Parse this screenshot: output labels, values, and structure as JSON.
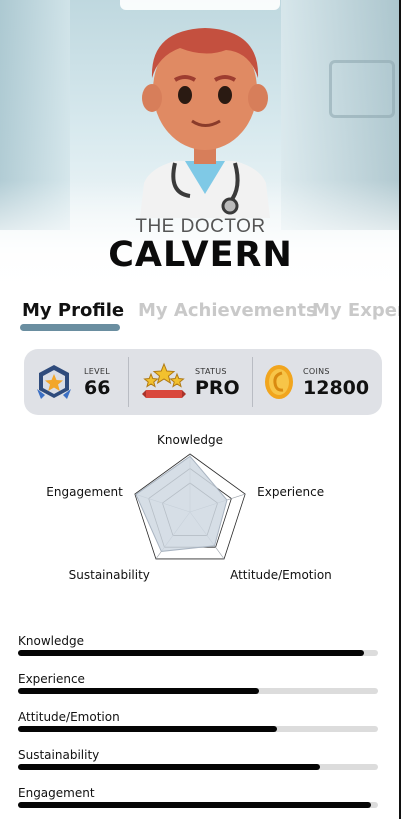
{
  "profile": {
    "subtitle": "THE DOCTOR",
    "name": "CALVERN"
  },
  "tabs": [
    {
      "label": "My Profile",
      "active": true
    },
    {
      "label": "My Achievements",
      "active": false
    },
    {
      "label": "My Exper",
      "active": false
    }
  ],
  "stats": {
    "level": {
      "label": "LEVEL",
      "value": "66",
      "icon": "level-badge-icon"
    },
    "status": {
      "label": "STATUS",
      "value": "PRO",
      "icon": "stars-ribbon-icon"
    },
    "coins": {
      "label": "COINS",
      "value": "12800",
      "icon": "coin-icon"
    }
  },
  "radar": {
    "axes": [
      "Knowledge",
      "Experience",
      "Attitude/Emotion",
      "Sustainability",
      "Engagement"
    ],
    "values": [
      0.96,
      0.67,
      0.72,
      0.84,
      0.98
    ]
  },
  "skills": [
    {
      "label": "Knowledge",
      "value": 0.96
    },
    {
      "label": "Experience",
      "value": 0.67
    },
    {
      "label": "Attitude/Emotion",
      "value": 0.72
    },
    {
      "label": "Sustainability",
      "value": 0.84
    },
    {
      "label": "Engagement",
      "value": 0.98
    }
  ],
  "colors": {
    "tab_underline": "#6a8ea0",
    "stats_panel": "#dfe1e6",
    "bar_fill": "#050505",
    "bar_track": "#dcdcdc",
    "radar_fill": "#cfd8e2"
  }
}
